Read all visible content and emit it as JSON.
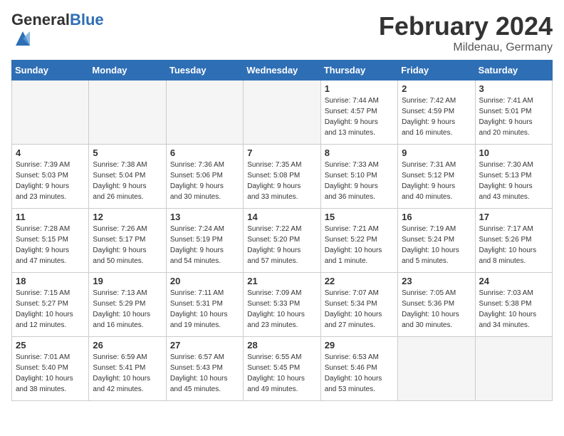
{
  "header": {
    "logo_general": "General",
    "logo_blue": "Blue",
    "month_title": "February 2024",
    "location": "Mildenau, Germany"
  },
  "days_of_week": [
    "Sunday",
    "Monday",
    "Tuesday",
    "Wednesday",
    "Thursday",
    "Friday",
    "Saturday"
  ],
  "weeks": [
    [
      {
        "day": "",
        "info": ""
      },
      {
        "day": "",
        "info": ""
      },
      {
        "day": "",
        "info": ""
      },
      {
        "day": "",
        "info": ""
      },
      {
        "day": "1",
        "info": "Sunrise: 7:44 AM\nSunset: 4:57 PM\nDaylight: 9 hours\nand 13 minutes."
      },
      {
        "day": "2",
        "info": "Sunrise: 7:42 AM\nSunset: 4:59 PM\nDaylight: 9 hours\nand 16 minutes."
      },
      {
        "day": "3",
        "info": "Sunrise: 7:41 AM\nSunset: 5:01 PM\nDaylight: 9 hours\nand 20 minutes."
      }
    ],
    [
      {
        "day": "4",
        "info": "Sunrise: 7:39 AM\nSunset: 5:03 PM\nDaylight: 9 hours\nand 23 minutes."
      },
      {
        "day": "5",
        "info": "Sunrise: 7:38 AM\nSunset: 5:04 PM\nDaylight: 9 hours\nand 26 minutes."
      },
      {
        "day": "6",
        "info": "Sunrise: 7:36 AM\nSunset: 5:06 PM\nDaylight: 9 hours\nand 30 minutes."
      },
      {
        "day": "7",
        "info": "Sunrise: 7:35 AM\nSunset: 5:08 PM\nDaylight: 9 hours\nand 33 minutes."
      },
      {
        "day": "8",
        "info": "Sunrise: 7:33 AM\nSunset: 5:10 PM\nDaylight: 9 hours\nand 36 minutes."
      },
      {
        "day": "9",
        "info": "Sunrise: 7:31 AM\nSunset: 5:12 PM\nDaylight: 9 hours\nand 40 minutes."
      },
      {
        "day": "10",
        "info": "Sunrise: 7:30 AM\nSunset: 5:13 PM\nDaylight: 9 hours\nand 43 minutes."
      }
    ],
    [
      {
        "day": "11",
        "info": "Sunrise: 7:28 AM\nSunset: 5:15 PM\nDaylight: 9 hours\nand 47 minutes."
      },
      {
        "day": "12",
        "info": "Sunrise: 7:26 AM\nSunset: 5:17 PM\nDaylight: 9 hours\nand 50 minutes."
      },
      {
        "day": "13",
        "info": "Sunrise: 7:24 AM\nSunset: 5:19 PM\nDaylight: 9 hours\nand 54 minutes."
      },
      {
        "day": "14",
        "info": "Sunrise: 7:22 AM\nSunset: 5:20 PM\nDaylight: 9 hours\nand 57 minutes."
      },
      {
        "day": "15",
        "info": "Sunrise: 7:21 AM\nSunset: 5:22 PM\nDaylight: 10 hours\nand 1 minute."
      },
      {
        "day": "16",
        "info": "Sunrise: 7:19 AM\nSunset: 5:24 PM\nDaylight: 10 hours\nand 5 minutes."
      },
      {
        "day": "17",
        "info": "Sunrise: 7:17 AM\nSunset: 5:26 PM\nDaylight: 10 hours\nand 8 minutes."
      }
    ],
    [
      {
        "day": "18",
        "info": "Sunrise: 7:15 AM\nSunset: 5:27 PM\nDaylight: 10 hours\nand 12 minutes."
      },
      {
        "day": "19",
        "info": "Sunrise: 7:13 AM\nSunset: 5:29 PM\nDaylight: 10 hours\nand 16 minutes."
      },
      {
        "day": "20",
        "info": "Sunrise: 7:11 AM\nSunset: 5:31 PM\nDaylight: 10 hours\nand 19 minutes."
      },
      {
        "day": "21",
        "info": "Sunrise: 7:09 AM\nSunset: 5:33 PM\nDaylight: 10 hours\nand 23 minutes."
      },
      {
        "day": "22",
        "info": "Sunrise: 7:07 AM\nSunset: 5:34 PM\nDaylight: 10 hours\nand 27 minutes."
      },
      {
        "day": "23",
        "info": "Sunrise: 7:05 AM\nSunset: 5:36 PM\nDaylight: 10 hours\nand 30 minutes."
      },
      {
        "day": "24",
        "info": "Sunrise: 7:03 AM\nSunset: 5:38 PM\nDaylight: 10 hours\nand 34 minutes."
      }
    ],
    [
      {
        "day": "25",
        "info": "Sunrise: 7:01 AM\nSunset: 5:40 PM\nDaylight: 10 hours\nand 38 minutes."
      },
      {
        "day": "26",
        "info": "Sunrise: 6:59 AM\nSunset: 5:41 PM\nDaylight: 10 hours\nand 42 minutes."
      },
      {
        "day": "27",
        "info": "Sunrise: 6:57 AM\nSunset: 5:43 PM\nDaylight: 10 hours\nand 45 minutes."
      },
      {
        "day": "28",
        "info": "Sunrise: 6:55 AM\nSunset: 5:45 PM\nDaylight: 10 hours\nand 49 minutes."
      },
      {
        "day": "29",
        "info": "Sunrise: 6:53 AM\nSunset: 5:46 PM\nDaylight: 10 hours\nand 53 minutes."
      },
      {
        "day": "",
        "info": ""
      },
      {
        "day": "",
        "info": ""
      }
    ]
  ]
}
